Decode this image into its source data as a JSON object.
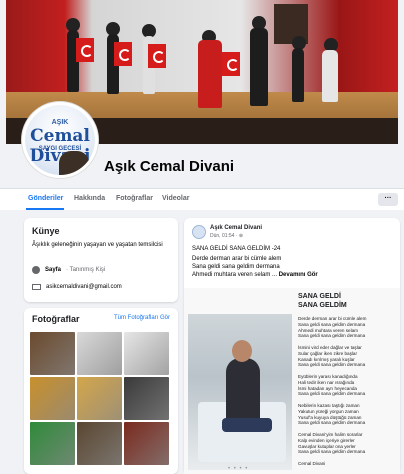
{
  "page": {
    "name": "Aşık Cemal Divani"
  },
  "logo": {
    "line1": "AŞIK",
    "line2": "Cemal Divani",
    "line3": "SAYGI GECESİ"
  },
  "tabs": [
    {
      "label": "Gönderiler",
      "active": true
    },
    {
      "label": "Hakkında",
      "active": false
    },
    {
      "label": "Fotoğraflar",
      "active": false
    },
    {
      "label": "Videolar",
      "active": false
    }
  ],
  "more_label": "···",
  "about": {
    "title": "Künye",
    "description": "Âşıklık geleneğinin yaşayan ve yaşatan temsilcisi",
    "type_label": "Sayfa",
    "type_value": "· Tanınmış Kişi",
    "email": "asikcemaldivani@gmail.com"
  },
  "photos_card": {
    "title": "Fotoğraflar",
    "see_all": "Tüm Fotoğrafları Gör",
    "thumb_colors": [
      "#6b4a2e",
      "#d9d9d9",
      "#e6e6e6",
      "#c9902c",
      "#d4a64a",
      "#3a3a3a",
      "#2f8a3a",
      "#5a4630",
      "#7a2a1e"
    ]
  },
  "post": {
    "author": "Aşık Cemal Divani",
    "meta": "Dün, 01:54 · ⊕",
    "title": "SANA GELDİ SANA GELDİM -24",
    "lines": [
      "Derde derman arar bi cümle alem",
      "Sana geldi sana geldim dermana",
      "Ahmedi muhtara veren selam ..."
    ],
    "see_more": "Devamını Gör"
  },
  "poem": {
    "title1": "SANA GELDİ",
    "title2": "SANA GELDİM",
    "stanzas": [
      "Derde derman arar bi cümle alem",
      "Sana geldi sana geldim dermana",
      "Ahmedi muhtara veren selam",
      "Sana geldi sana geldim dermana",
      "",
      "İsmini vird eder dağlar ve taşlar",
      "Sular çağlar iken zikre başlar",
      "Kanadı kırılmış yaralı kuşlar",
      "Sana geldi sana geldim dermana",
      "",
      "Eyüblerin yarası kanadığında",
      "Hali tedir iken nar ısrağında",
      "İsmi hatadan ayrı heyecanda",
      "Sana geldi sana geldim dermana",
      "",
      "Nebilerin kazası taştığı zaman",
      "Yakutun yüreği yorgun zaman",
      "Yusuf'a kuyuya düştüğü zaman",
      "Sana geldi sana geldim dermana",
      "",
      "Cemal Divani'yim halim sorarlar",
      "Kalp evinden içeriye girerler",
      "Gavuşlar kutuplar ona yerler",
      "Sana geldi sana geldim dermana",
      "",
      "Cemal Divani"
    ]
  },
  "pager_dots": "• • • •"
}
